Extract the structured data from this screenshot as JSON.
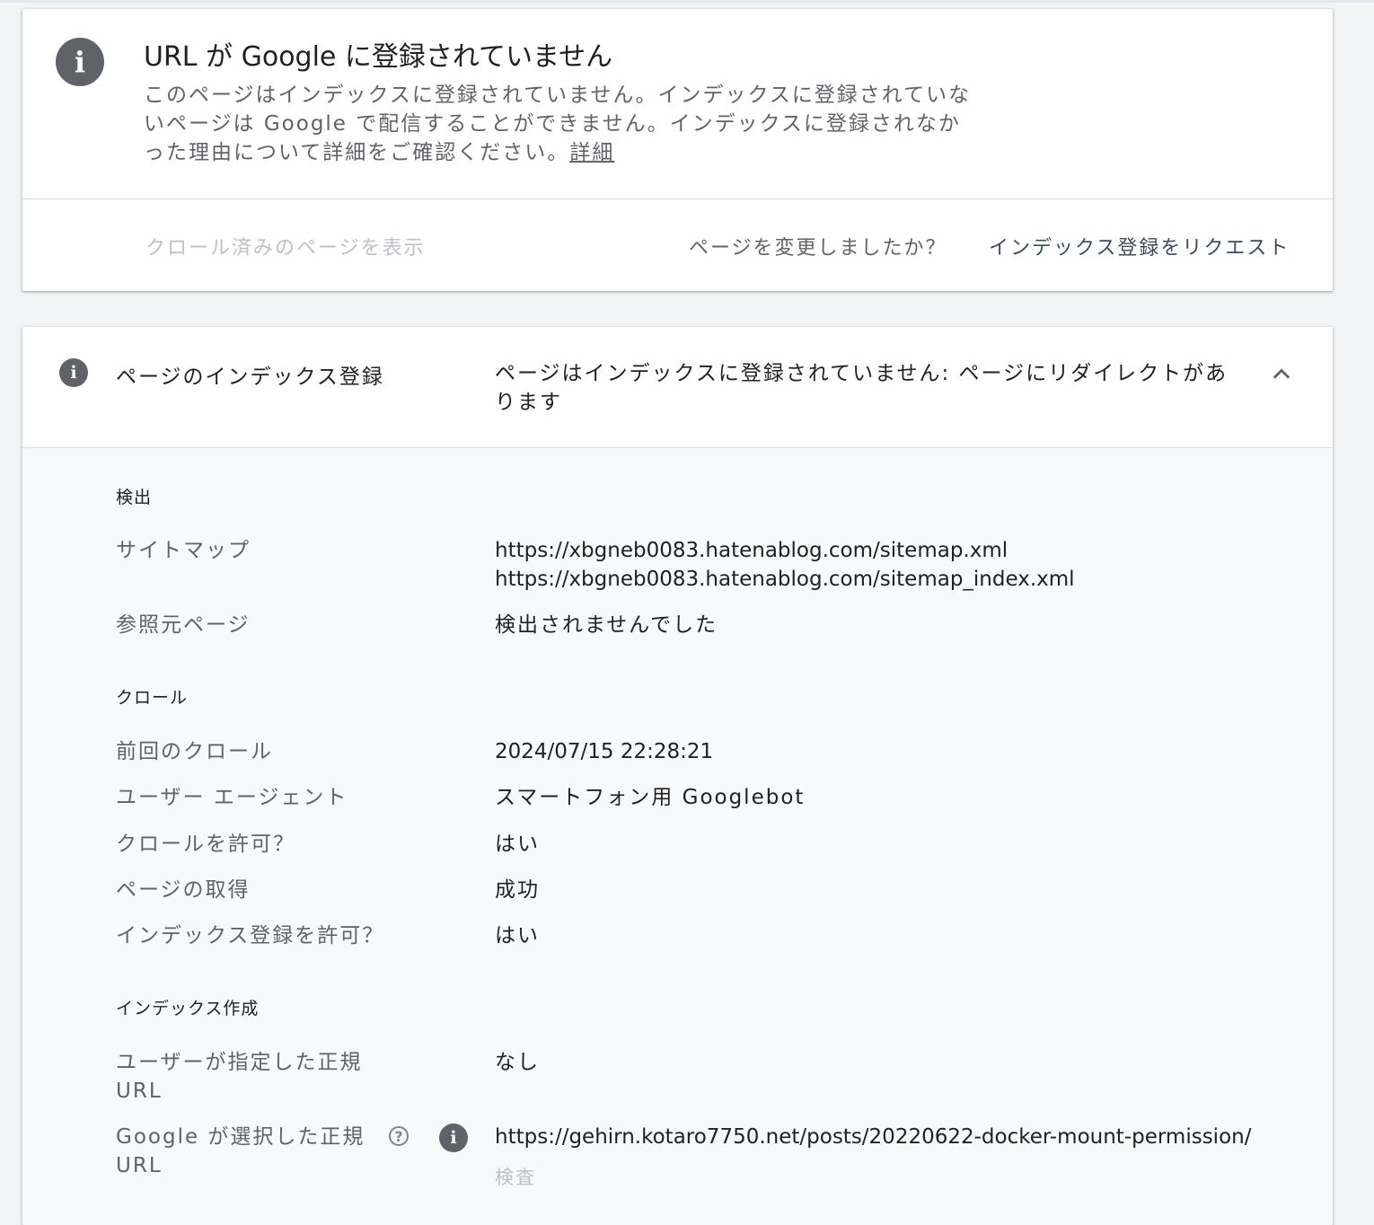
{
  "status_card": {
    "title": "URL が Google に登録されていません",
    "description": "このページはインデックスに登録されていません。インデックスに登録されていないページは Google で配信することができません。インデックスに登録されなかった理由について詳細をご確認ください。",
    "learn_more": "詳細",
    "icon": "info-icon",
    "view_crawled": "クロール済みのページを表示",
    "page_changed": "ページを変更しましたか？",
    "request_indexing": "インデックス登録をリクエスト"
  },
  "indexing_section": {
    "title": "ページのインデックス登録",
    "status": "ページはインデックスに登録されていません: ページにリダイレクトがあります",
    "icon": "info-icon",
    "toggle_icon": "chevron-up-icon",
    "discovery": {
      "heading": "検出",
      "sitemap_label": "サイトマップ",
      "sitemaps": [
        "https://xbgneb0083.hatenablog.com/sitemap.xml",
        "https://xbgneb0083.hatenablog.com/sitemap_index.xml"
      ],
      "referring_label": "参照元ページ",
      "referring_value": "検出されませんでした"
    },
    "crawl": {
      "heading": "クロール",
      "rows": [
        {
          "label": "前回のクロール",
          "value": "2024/07/15 22:28:21"
        },
        {
          "label": "ユーザー エージェント",
          "value": "スマートフォン用 Googlebot"
        },
        {
          "label": "クロールを許可？",
          "value": "はい"
        },
        {
          "label": "ページの取得",
          "value": "成功"
        },
        {
          "label": "インデックス登録を許可？",
          "value": "はい"
        }
      ]
    },
    "indexing": {
      "heading": "インデックス作成",
      "user_canonical_label_1": "ユーザーが指定した正規",
      "user_canonical_label_2": "URL",
      "user_canonical_value": "なし",
      "google_canonical_label_1": "Google が選択した正規",
      "google_canonical_label_2": "URL",
      "google_canonical_value": "https://gehirn.kotaro7750.net/posts/20220622-docker-mount-permission/",
      "inspect_label": "検査",
      "help_icon": "help-icon"
    }
  }
}
